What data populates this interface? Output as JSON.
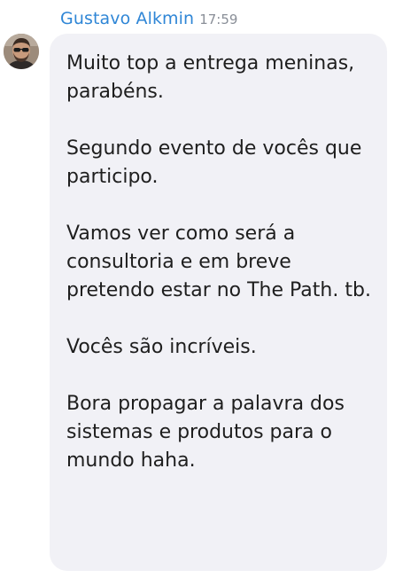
{
  "message": {
    "sender_name": "Gustavo Alkmin",
    "timestamp": "17:59",
    "avatar_icon": "user-avatar-photo",
    "colors": {
      "sender": "#2f86d6",
      "timestamp": "#8a8f98",
      "bubble_background": "#f1f1f6",
      "text": "#1e1e1e"
    },
    "paragraphs": [
      "Muito top a entrega meninas, parabéns.",
      "Segundo evento de vocês que participo.",
      "Vamos ver como será a consultoria e em breve pretendo estar no The Path. tb.",
      "Vocês são incríveis.",
      "Bora propagar a palavra dos sistemas e produtos para o mundo haha."
    ]
  }
}
